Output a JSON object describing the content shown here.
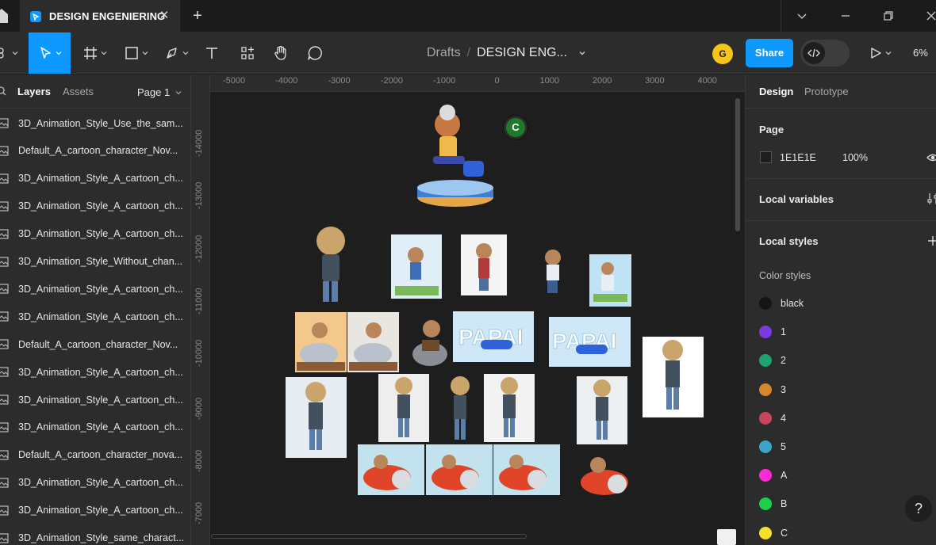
{
  "tab": {
    "title": "DESIGN ENGENIERING",
    "close": "✕",
    "add": "+"
  },
  "toolbar": {
    "breadcrumb_root": "Drafts",
    "breadcrumb_sep": "/",
    "file_name": "DESIGN ENG...",
    "avatar": "G",
    "share_label": "Share",
    "zoom": "6%"
  },
  "left_panel": {
    "tabs": {
      "layers": "Layers",
      "assets": "Assets"
    },
    "page_selector": "Page 1",
    "layers": [
      "3D_Animation_Style_Use_the_sam...",
      "Default_A_cartoon_character_Nov...",
      "3D_Animation_Style_A_cartoon_ch...",
      "3D_Animation_Style_A_cartoon_ch...",
      "3D_Animation_Style_A_cartoon_ch...",
      "3D_Animation_Style_Without_chan...",
      "3D_Animation_Style_A_cartoon_ch...",
      "3D_Animation_Style_A_cartoon_ch...",
      "Default_A_cartoon_character_Nov...",
      "3D_Animation_Style_A_cartoon_ch...",
      "3D_Animation_Style_A_cartoon_ch...",
      "3D_Animation_Style_A_cartoon_ch...",
      "Default_A_cartoon_character_nova...",
      "3D_Animation_Style_A_cartoon_ch...",
      "3D_Animation_Style_A_cartoon_ch...",
      "3D_Animation_Style_same_charact..."
    ]
  },
  "canvas": {
    "ruler_x": [
      "-5000",
      "-4000",
      "-3000",
      "-2000",
      "-1000",
      "0",
      "1000",
      "2000",
      "3000",
      "4000"
    ],
    "ruler_y": [
      "-14000",
      "-13000",
      "-12000",
      "-11000",
      "-10000",
      "-9000",
      "-8000",
      "-7000"
    ],
    "collaborator": "C"
  },
  "right_panel": {
    "tabs": {
      "design": "Design",
      "prototype": "Prototype"
    },
    "page_section": {
      "title": "Page",
      "color_hex": "1E1E1E",
      "opacity": "100%"
    },
    "local_variables": "Local variables",
    "local_styles": "Local styles",
    "color_styles_label": "Color styles",
    "color_styles": [
      {
        "name": "black",
        "color": "#151515"
      },
      {
        "name": "1",
        "color": "#7a3ce0"
      },
      {
        "name": "2",
        "color": "#1fa36f"
      },
      {
        "name": "3",
        "color": "#d9862a"
      },
      {
        "name": "4",
        "color": "#c9465e"
      },
      {
        "name": "5",
        "color": "#3aa5c5"
      },
      {
        "name": "A",
        "color": "#ff2bd6"
      },
      {
        "name": "B",
        "color": "#1bd14a"
      },
      {
        "name": "C",
        "color": "#f5e12a"
      }
    ],
    "help": "?"
  }
}
